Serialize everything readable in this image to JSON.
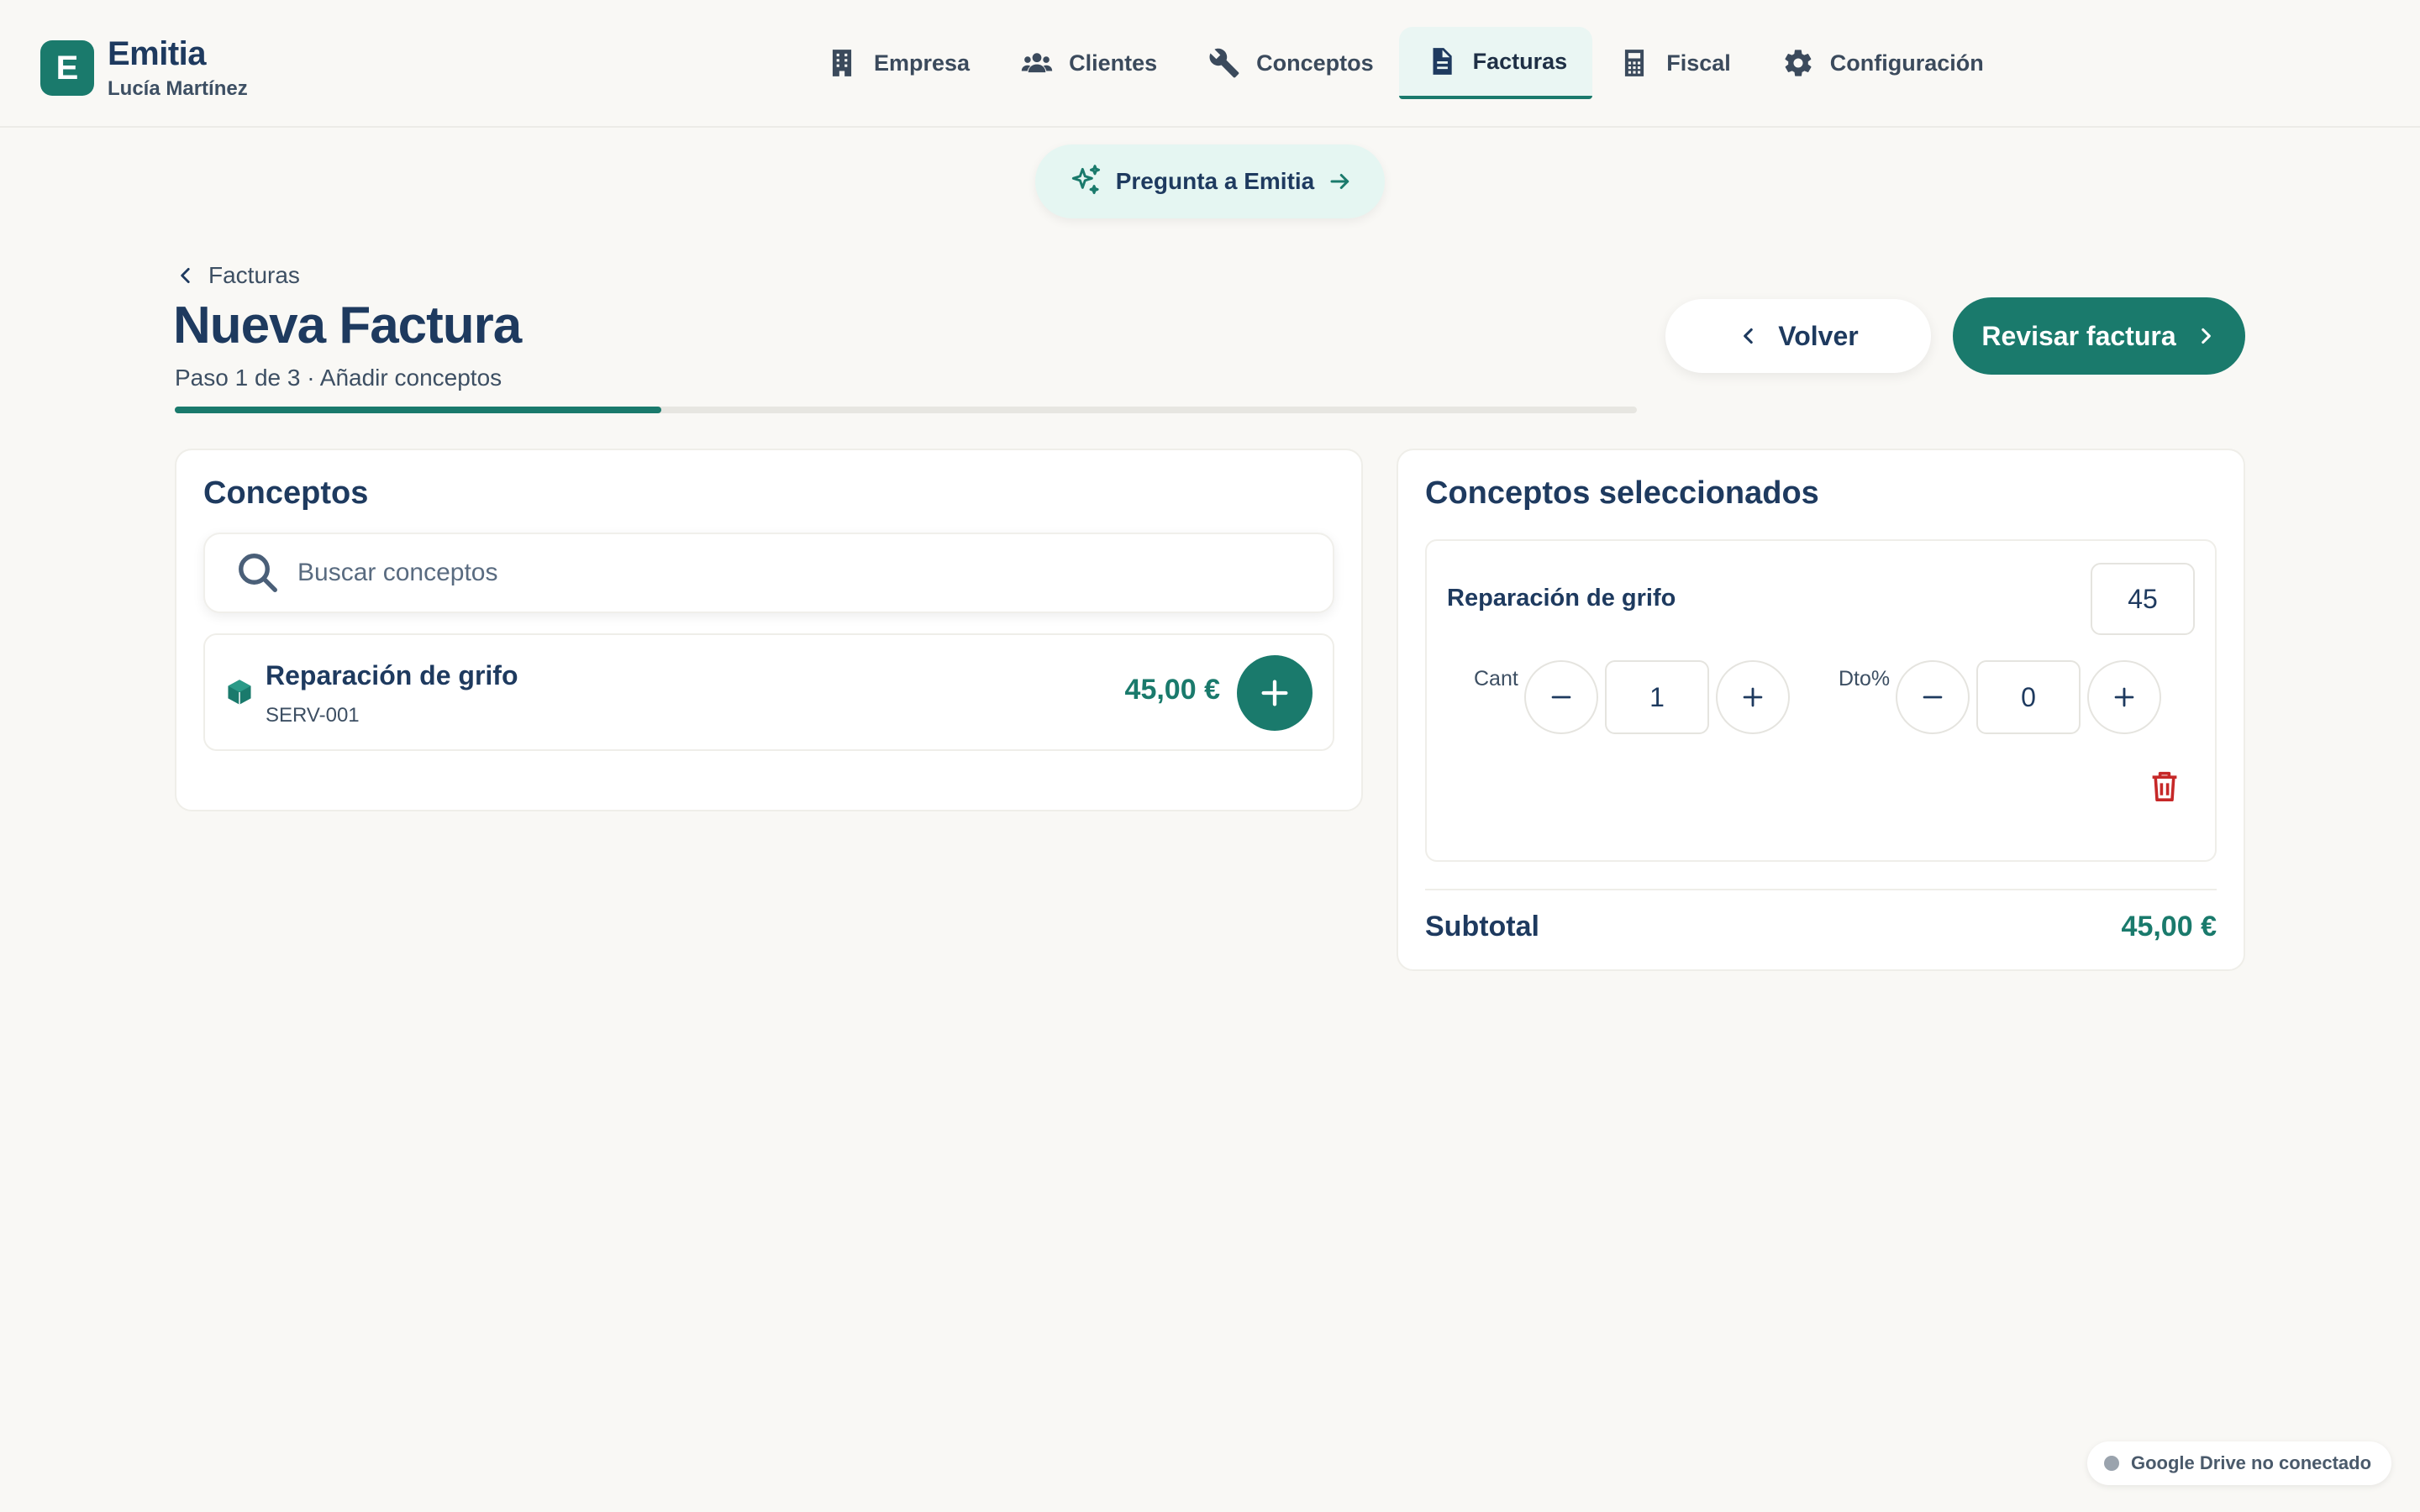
{
  "brand": {
    "logo_letter": "E",
    "name": "Emitia",
    "user": "Lucía Martínez"
  },
  "nav": {
    "items": [
      {
        "label": "Empresa",
        "icon": "building-icon"
      },
      {
        "label": "Clientes",
        "icon": "users-icon"
      },
      {
        "label": "Conceptos",
        "icon": "wrench-icon"
      },
      {
        "label": "Facturas",
        "icon": "document-icon",
        "active": true
      },
      {
        "label": "Fiscal",
        "icon": "calculator-icon"
      },
      {
        "label": "Configuración",
        "icon": "gear-icon"
      }
    ]
  },
  "ask": {
    "label": "Pregunta a Emitia",
    "icon": "sparkles-icon"
  },
  "breadcrumb": {
    "label": "Facturas"
  },
  "page": {
    "title": "Nueva Factura",
    "subtitle": "Paso 1 de 3 · Añadir conceptos",
    "progress_fraction": 0.333
  },
  "actions": {
    "back_label": "Volver",
    "review_label": "Revisar factura"
  },
  "concepts_panel": {
    "title": "Conceptos",
    "search_placeholder": "Buscar conceptos",
    "items": [
      {
        "name": "Reparación de grifo",
        "code": "SERV-001",
        "price": "45,00 €"
      }
    ]
  },
  "selected_panel": {
    "title": "Conceptos seleccionados",
    "items": [
      {
        "name": "Reparación de grifo",
        "price": "45",
        "qty_label": "Cant",
        "qty": "1",
        "discount_label": "Dto%",
        "discount": "0"
      }
    ],
    "subtotal_label": "Subtotal",
    "subtotal_value": "45,00 €"
  },
  "status": {
    "drive": "Google Drive no conectado"
  },
  "colors": {
    "accent": "#1a7a6c",
    "text": "#1e3a5f",
    "danger": "#c62828",
    "background": "#f9f8f5"
  }
}
